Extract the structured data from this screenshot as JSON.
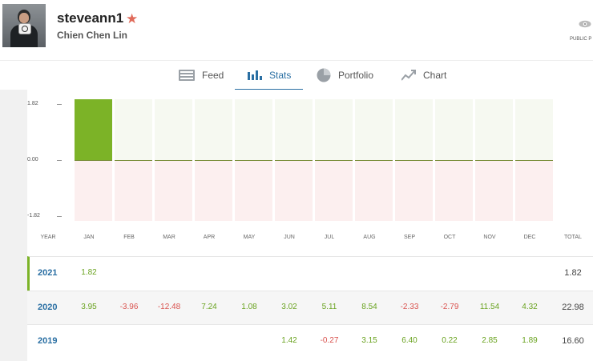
{
  "profile": {
    "username": "steveann1",
    "fullname": "Chien Chen Lin",
    "public_label": "PUBLIC P",
    "star_color": "#e06a5a"
  },
  "tabs": [
    {
      "label": "Feed",
      "icon": "feed-icon"
    },
    {
      "label": "Stats",
      "icon": "stats-icon",
      "active": true
    },
    {
      "label": "Portfolio",
      "icon": "portfolio-icon"
    },
    {
      "label": "Chart",
      "icon": "chart-icon"
    }
  ],
  "chart_data": {
    "type": "bar",
    "categories": [
      "JAN",
      "FEB",
      "MAR",
      "APR",
      "MAY",
      "JUN",
      "JUL",
      "AUG",
      "SEP",
      "OCT",
      "NOV",
      "DEC"
    ],
    "values": [
      1.82,
      0,
      0,
      0,
      0,
      0,
      0,
      0,
      0,
      0,
      0,
      0
    ],
    "ylim": [
      -1.82,
      1.82
    ],
    "yticks": [
      "1.82",
      "0.00",
      "-1.82"
    ],
    "colors": {
      "positive": "#7cb327",
      "negative": "#d9534f"
    }
  },
  "table": {
    "headers": {
      "year": "YEAR",
      "total": "TOTAL"
    },
    "months": [
      "JAN",
      "FEB",
      "MAR",
      "APR",
      "MAY",
      "JUN",
      "JUL",
      "AUG",
      "SEP",
      "OCT",
      "NOV",
      "DEC"
    ],
    "rows": [
      {
        "year": "2021",
        "values": [
          "1.82",
          "",
          "",
          "",
          "",
          "",
          "",
          "",
          "",
          "",
          "",
          ""
        ],
        "total": "1.82"
      },
      {
        "year": "2020",
        "values": [
          "3.95",
          "-3.96",
          "-12.48",
          "7.24",
          "1.08",
          "3.02",
          "5.11",
          "8.54",
          "-2.33",
          "-2.79",
          "11.54",
          "4.32"
        ],
        "total": "22.98"
      },
      {
        "year": "2019",
        "values": [
          "",
          "",
          "",
          "",
          "",
          "1.42",
          "-0.27",
          "3.15",
          "6.40",
          "0.22",
          "2.85",
          "1.89"
        ],
        "total": "16.60"
      }
    ]
  }
}
